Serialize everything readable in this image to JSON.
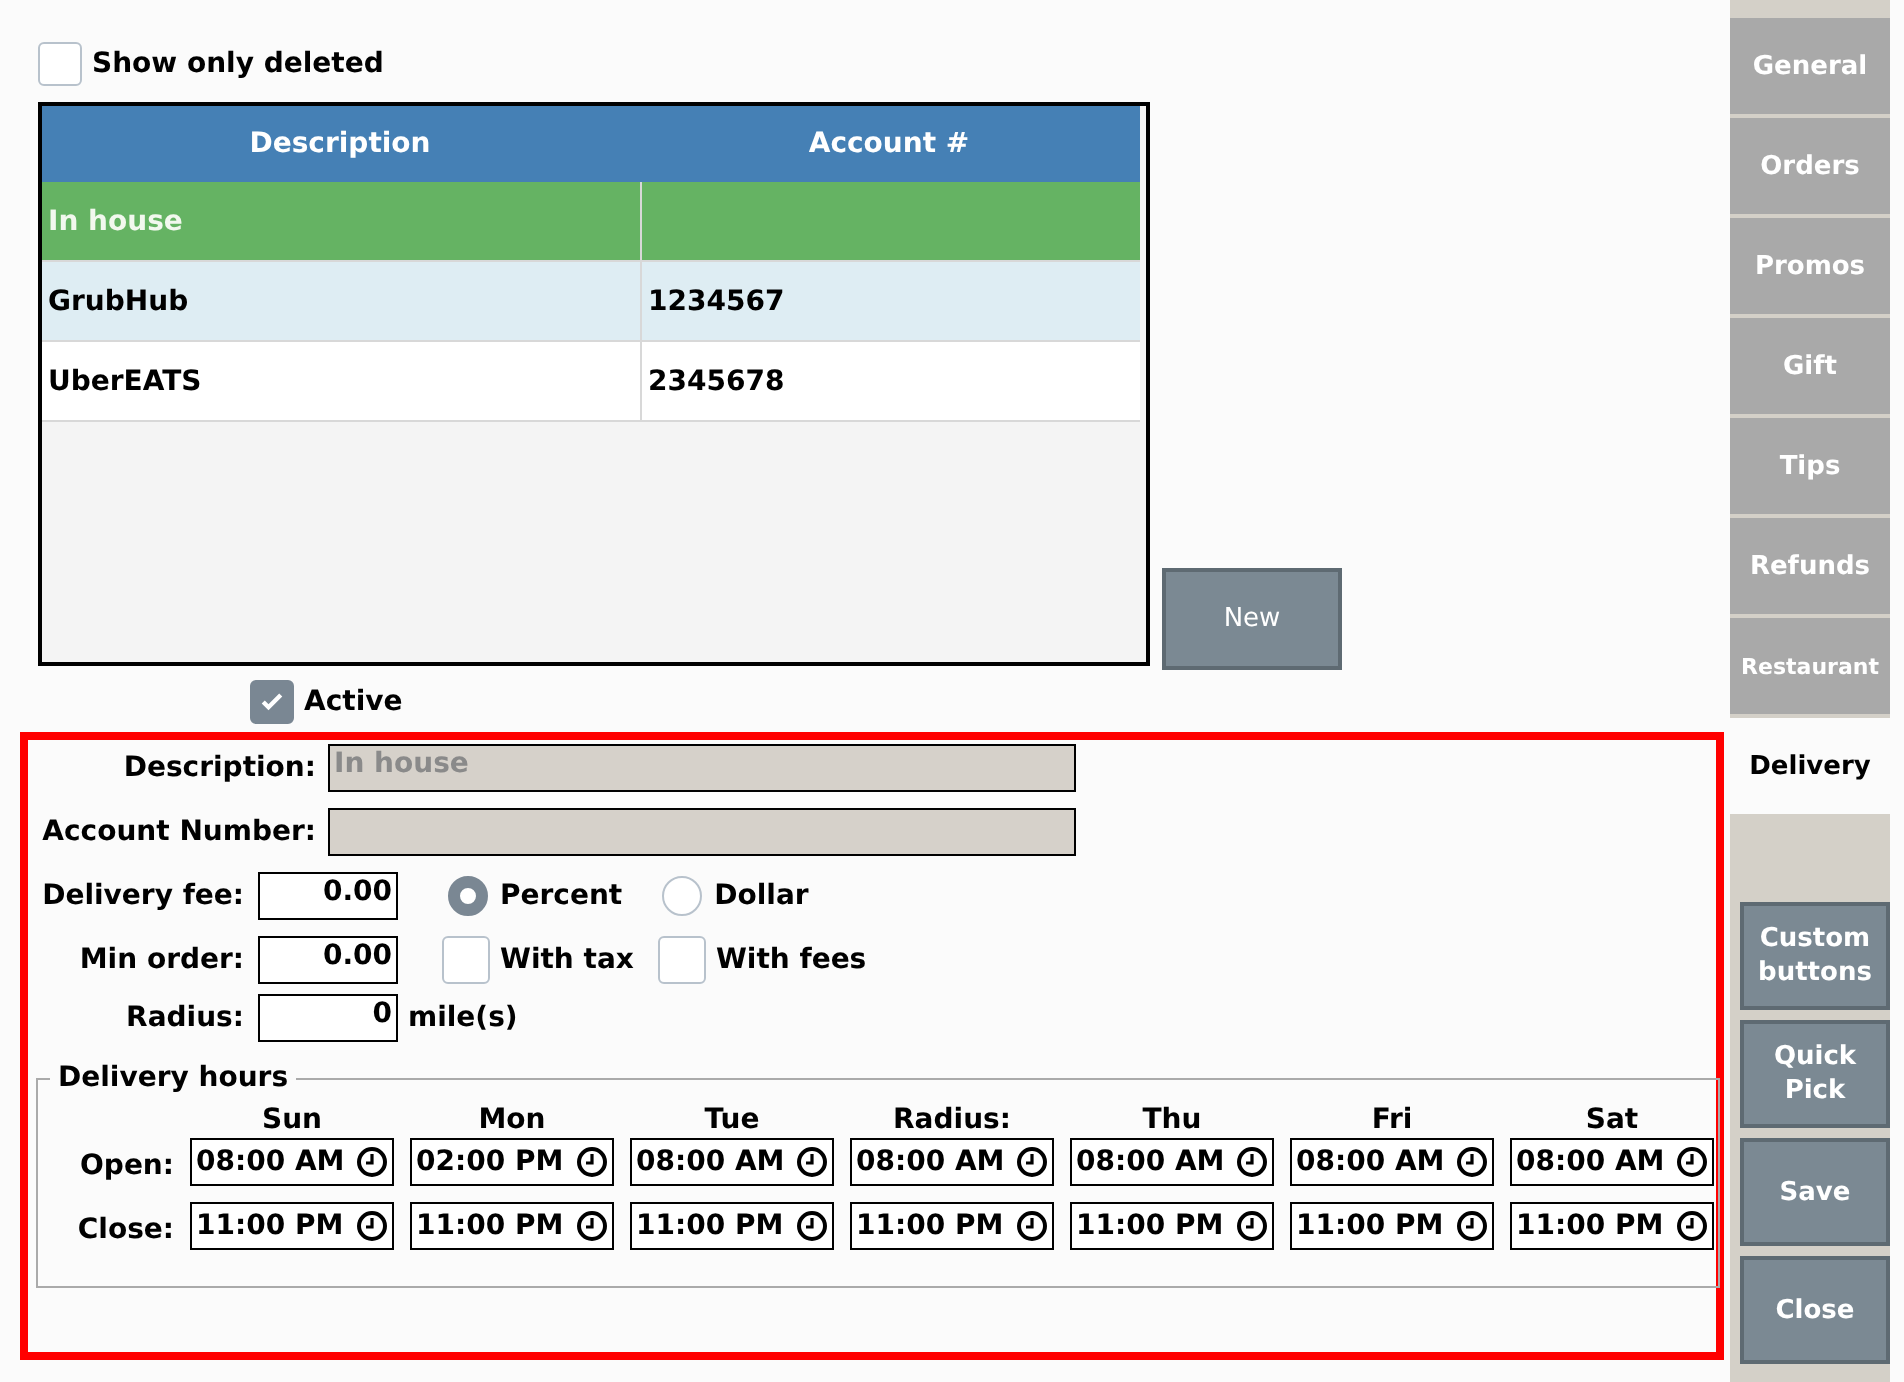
{
  "filter": {
    "label": "Show only deleted",
    "checked": false
  },
  "table": {
    "columns": [
      "Description",
      "Account #"
    ],
    "rows": [
      {
        "description": "In house",
        "selected": true
      },
      {
        "description": "GrubHub",
        "account": "1234567",
        "selected": false
      },
      {
        "description": "UberEATS",
        "account": "2345678",
        "selected": false
      }
    ]
  },
  "new_button": "New",
  "active": {
    "label": "Active",
    "checked": true
  },
  "form": {
    "description": {
      "label": "Description:",
      "value": "In house",
      "disabled": true
    },
    "account_number": {
      "label": "Account Number:",
      "disabled": true
    },
    "delivery_fee": {
      "label": "Delivery fee:",
      "value": "0.00"
    },
    "fee_type": [
      {
        "label": "Percent",
        "selected": true
      },
      {
        "label": "Dollar",
        "selected": false
      }
    ],
    "min_order": {
      "label": "Min order:",
      "value": "0.00"
    },
    "min_order_options": [
      {
        "label": "With tax",
        "checked": false
      },
      {
        "label": "With fees",
        "checked": false
      }
    ],
    "radius": {
      "label": "Radius:",
      "value": "0",
      "unit": "mile(s)"
    }
  },
  "delivery_hours": {
    "title": "Delivery hours",
    "open_label": "Open:",
    "close_label": "Close:",
    "days": [
      {
        "name": "Sun",
        "open": "08:00 AM",
        "close": "11:00 PM"
      },
      {
        "name": "Mon",
        "open": "02:00 PM",
        "close": "11:00 PM"
      },
      {
        "name": "Tue",
        "open": "08:00 AM",
        "close": "11:00 PM"
      },
      {
        "name": "Radius:",
        "open": "08:00 AM",
        "close": "11:00 PM"
      },
      {
        "name": "Thu",
        "open": "08:00 AM",
        "close": "11:00 PM"
      },
      {
        "name": "Fri",
        "open": "08:00 AM",
        "close": "11:00 PM"
      },
      {
        "name": "Sat",
        "open": "08:00 AM",
        "close": "11:00 PM"
      }
    ]
  },
  "tabs": [
    {
      "label": "General",
      "selected": false
    },
    {
      "label": "Orders",
      "selected": false
    },
    {
      "label": "Promos",
      "selected": false
    },
    {
      "label": "Gift",
      "selected": false
    },
    {
      "label": "Tips",
      "selected": false
    },
    {
      "label": "Refunds",
      "selected": false
    },
    {
      "label": "Restaurant",
      "selected": false
    },
    {
      "label": "Delivery",
      "selected": true
    }
  ],
  "side_buttons": [
    "Custom buttons",
    "Quick Pick",
    "Save",
    "Close"
  ]
}
